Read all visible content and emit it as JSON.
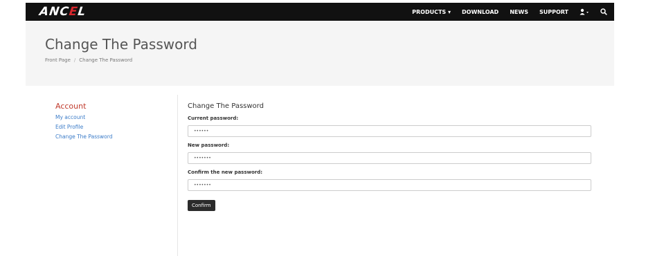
{
  "brand": {
    "logo_main": "ANC",
    "logo_accent": "E",
    "logo_end": "L"
  },
  "nav": {
    "products": "PRODUCTS ▾",
    "download": "DOWNLOAD",
    "news": "NEWS",
    "support": "SUPPORT",
    "user_icon": "user-icon",
    "search_icon": "search-icon"
  },
  "hero": {
    "title": "Change The Password",
    "breadcrumb": {
      "home": "Front Page",
      "separator": "/",
      "current": "Change The Password"
    }
  },
  "sidebar": {
    "title": "Account",
    "items": [
      {
        "label": "My account"
      },
      {
        "label": "Edit Profile"
      },
      {
        "label": "Change The Password"
      }
    ]
  },
  "form": {
    "title": "Change The Password",
    "current_label": "Current password:",
    "current_value": "••••••",
    "new_label": "New password:",
    "new_value": "•••••••",
    "confirm_label": "Confirm the new password:",
    "confirm_value": "•••••••",
    "submit_label": "Confirm"
  },
  "colors": {
    "navbar": "#111111",
    "hero_bg": "#f5f5f5",
    "accent": "#c0392b",
    "link": "#3a7bc8",
    "button": "#2b2b2b"
  }
}
